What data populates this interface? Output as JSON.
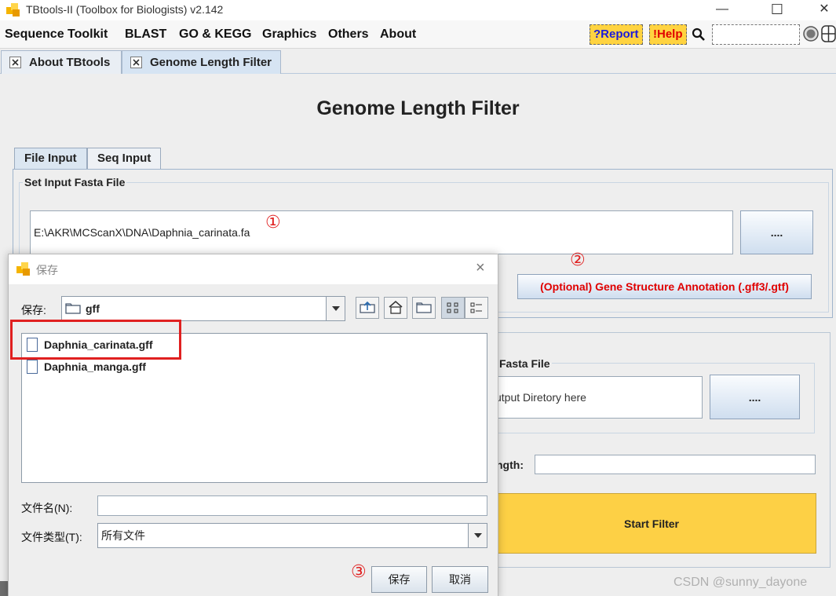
{
  "window": {
    "title": "TBtools-II (Toolbox for Biologists) v2.142",
    "minimize": "—",
    "maximize": "☐",
    "close": "✕"
  },
  "menu": {
    "items": [
      "Sequence Toolkit",
      "BLAST",
      "GO & KEGG",
      "Graphics",
      "Others",
      "About"
    ],
    "report": "?Report",
    "help": "!Help"
  },
  "tabs": [
    "About TBtools",
    "Genome Length Filter"
  ],
  "page": {
    "title": "Genome Length Filter",
    "inner_tabs": [
      "File Input",
      "Seq Input"
    ],
    "input_group_title": "Set Input Fasta File",
    "input_path": "E:\\AKR\\MCScanX\\DNA\\Daphnia_carinata.fa",
    "browse_label": "....",
    "annotation_button": "(Optional) Gene Structure Annotation (.gff3/.gtf)",
    "output_group_title_partial": "Fasta File",
    "output_placeholder_partial": "utput Diretory here",
    "length_label_partial": "ngth:",
    "length_value": "",
    "start_button": "Start Filter",
    "step1": "①",
    "step2": "②",
    "step3": "③"
  },
  "dialog": {
    "title": "保存",
    "save_in_label": "保存:",
    "folder": "gff",
    "files": [
      "Daphnia_carinata.gff",
      "Daphnia_manga.gff"
    ],
    "filename_label": "文件名(N):",
    "filename_value": "",
    "filetype_label": "文件类型(T):",
    "filetype_value": "所有文件",
    "save_button": "保存",
    "cancel_button": "取消",
    "close": "×"
  },
  "watermark": "CSDN @sunny_dayone",
  "colors": {
    "accent_yellow": "#fdd045",
    "annotation_red": "#e00000",
    "report_blue": "#1a1adb",
    "highlight_red": "#e02020"
  }
}
